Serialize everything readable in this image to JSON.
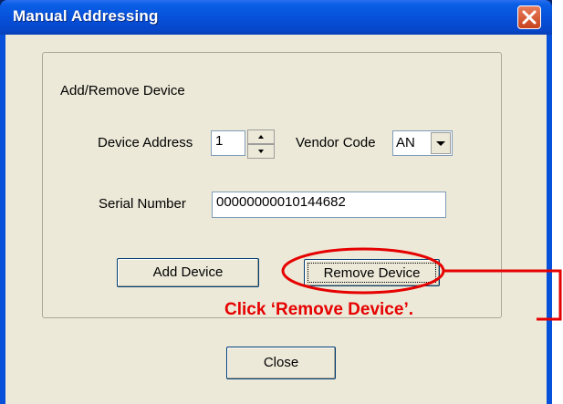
{
  "window": {
    "title": "Manual Addressing"
  },
  "group": {
    "legend": "Add/Remove Device"
  },
  "device_address": {
    "label": "Device Address",
    "value": "1"
  },
  "vendor_code": {
    "label": "Vendor Code",
    "value": "AN"
  },
  "serial_number": {
    "label": "Serial Number",
    "value": "00000000010144682"
  },
  "buttons": {
    "add_device": "Add Device",
    "remove_device": "Remove Device",
    "close": "Close"
  },
  "annotation": {
    "text": "Click ‘Remove Device’.",
    "color": "#e60000"
  },
  "colors": {
    "titlebar": "#0751da",
    "dialog_bg": "#ece9d8",
    "close_button": "#c8431d"
  },
  "icons": [
    "close-icon",
    "spin-up-icon",
    "spin-down-icon",
    "dropdown-arrow-icon"
  ]
}
